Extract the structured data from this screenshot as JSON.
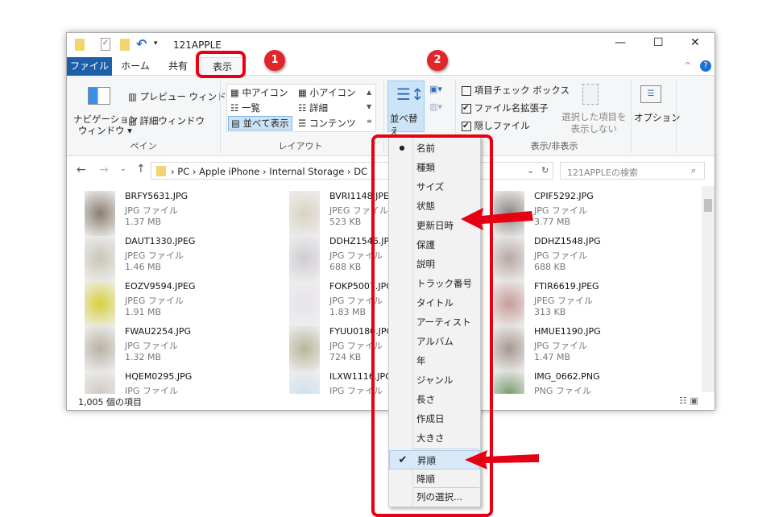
{
  "window": {
    "title": "121APPLE",
    "controls": [
      "—",
      "☐",
      "✕"
    ]
  },
  "tabs": [
    "ファイル",
    "ホーム",
    "共有",
    "表示"
  ],
  "ribbon": {
    "pane": {
      "nav": "ナビゲーション",
      "nav2": "ウィンドウ ▾",
      "preview": "プレビュー ウィンドウ",
      "details": "詳細ウィンドウ",
      "label": "ペイン"
    },
    "layout": {
      "items": [
        "中アイコン",
        "小アイコン",
        "一覧",
        "詳細",
        "並べて表示",
        "コンテンツ"
      ],
      "label": "レイアウト"
    },
    "sort": {
      "label": "並べ替え"
    },
    "show": {
      "checkbox": "項目チェック ボックス",
      "ext": "ファイル名拡張子",
      "hidden": "隠しファイル",
      "hide_sel1": "選択した項目を",
      "hide_sel2": "表示しない",
      "label": "表示/非表示",
      "checked": {
        "checkbox": false,
        "ext": true,
        "hidden": true
      }
    },
    "options": "オプション"
  },
  "address": {
    "path": [
      "PC",
      "Apple iPhone",
      "Internal Storage",
      "DC"
    ],
    "search_placeholder": "121APPLEの検索"
  },
  "files": [
    {
      "name": "BRFY5631.JPG",
      "type": "JPG ファイル",
      "size": "1.37 MB"
    },
    {
      "name": "DAUT1330.JPEG",
      "type": "JPEG ファイル",
      "size": "1.46 MB"
    },
    {
      "name": "EOZV9594.JPEG",
      "type": "JPEG ファイル",
      "size": "1.91 MB"
    },
    {
      "name": "FWAU2254.JPG",
      "type": "JPG ファイル",
      "size": "1.32 MB"
    },
    {
      "name": "HQEM0295.JPG",
      "type": "JPG ファイル",
      "size": ""
    },
    {
      "name": "BVRI1148.JPEG",
      "type": "JPEG ファイル",
      "size": "523 KB"
    },
    {
      "name": "DDHZ1546.JPG",
      "type": "JPG ファイル",
      "size": "688 KB"
    },
    {
      "name": "FOKP5007.JPG",
      "type": "JPG ファイル",
      "size": "1.83 MB"
    },
    {
      "name": "FYUU0180.JPG",
      "type": "JPG ファイル",
      "size": "724 KB"
    },
    {
      "name": "ILXW1116.JPG",
      "type": "JPG ファイル",
      "size": ""
    },
    {
      "name": "CPIF5292.JPG",
      "type": "JPG ファイル",
      "size": "3.77 MB"
    },
    {
      "name": "DDHZ1548.JPG",
      "type": "JPG ファイル",
      "size": "688 KB"
    },
    {
      "name": "FTIR6619.JPEG",
      "type": "JPEG ファイル",
      "size": "313 KB"
    },
    {
      "name": "HMUE1190.JPG",
      "type": "JPG ファイル",
      "size": "1.47 MB"
    },
    {
      "name": "IMG_0662.PNG",
      "type": "PNG ファイル",
      "size": ""
    }
  ],
  "status": "1,005 個の項目",
  "menu": {
    "items": [
      "名前",
      "種類",
      "サイズ",
      "状態",
      "更新日時",
      "保護",
      "説明",
      "トラック番号",
      "タイトル",
      "アーティスト",
      "アルバム",
      "年",
      "ジャンル",
      "長さ",
      "作成日",
      "大きさ"
    ],
    "selected": "名前",
    "order": [
      "昇順",
      "降順"
    ],
    "order_selected": "昇順",
    "columns": "列の選択..."
  },
  "badges": [
    "1",
    "2"
  ],
  "colors": {
    "accent": "#1e5fa9",
    "annotation": "#e60012"
  }
}
